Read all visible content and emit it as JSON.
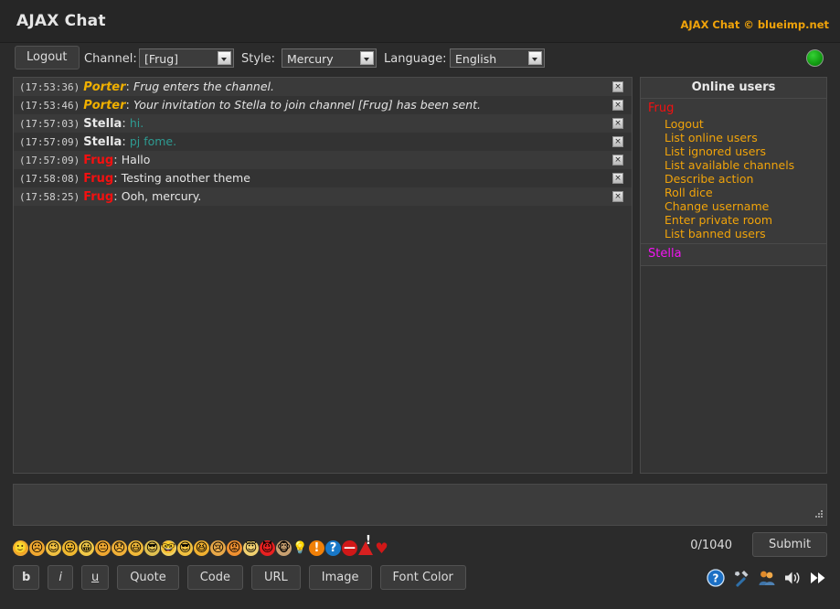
{
  "header": {
    "title": "AJAX Chat",
    "copyright_prefix": "AJAX Chat © ",
    "copyright_link": "blueimp.net"
  },
  "toolbar": {
    "logout_label": "Logout",
    "channel_label": "Channel:",
    "channel_value": "[Frug]",
    "style_label": "Style:",
    "style_value": "Mercury",
    "language_label": "Language:",
    "language_value": "English",
    "status": "online"
  },
  "messages": [
    {
      "time": "(17:53:36)",
      "user": "Porter",
      "user_class": "u-porter",
      "text": "Frug enters the channel.",
      "text_class": "t-action",
      "delete_label": "×"
    },
    {
      "time": "(17:53:46)",
      "user": "Porter",
      "user_class": "u-porter",
      "text": "Your invitation to Stella to join channel [Frug] has been sent.",
      "text_class": "t-action",
      "delete_label": "×"
    },
    {
      "time": "(17:57:03)",
      "user": "Stella",
      "user_class": "u-stella",
      "text": "hi.",
      "text_class": "t-teal",
      "delete_label": "×"
    },
    {
      "time": "(17:57:09)",
      "user": "Stella",
      "user_class": "u-stella",
      "text": "pj fome.",
      "text_class": "t-teal",
      "delete_label": "×"
    },
    {
      "time": "(17:57:09)",
      "user": "Frug",
      "user_class": "u-frug",
      "text": "Hallo",
      "text_class": "t-plain",
      "delete_label": "×"
    },
    {
      "time": "(17:58:08)",
      "user": "Frug",
      "user_class": "u-frug",
      "text": "Testing another theme",
      "text_class": "t-plain",
      "delete_label": "×"
    },
    {
      "time": "(17:58:25)",
      "user": "Frug",
      "user_class": "u-frug",
      "text": "Ooh, mercury.",
      "text_class": "t-plain",
      "delete_label": "×"
    }
  ],
  "users_panel": {
    "title": "Online users",
    "users": [
      {
        "name": "Frug",
        "color_class": "c-red",
        "menu": [
          "Logout",
          "List online users",
          "List ignored users",
          "List available channels",
          "Describe action",
          "Roll dice",
          "Change username",
          "Enter private room",
          "List banned users"
        ]
      },
      {
        "name": "Stella",
        "color_class": "c-magenta",
        "menu": []
      }
    ]
  },
  "input": {
    "value": "",
    "placeholder": ""
  },
  "emoticons": [
    {
      "name": "smile-emoticon",
      "glyph": "🙂",
      "bg": "#f0a830"
    },
    {
      "name": "frown-emoticon",
      "glyph": "☹",
      "bg": "#f0a830"
    },
    {
      "name": "wink-emoticon",
      "glyph": "😉",
      "bg": "#f0c040"
    },
    {
      "name": "tongue-emoticon",
      "glyph": "😛",
      "bg": "#f0b830"
    },
    {
      "name": "grin-emoticon",
      "glyph": "😀",
      "bg": "#f0c848"
    },
    {
      "name": "neutral-emoticon",
      "glyph": "😐",
      "bg": "#f0a830"
    },
    {
      "name": "sad-emoticon",
      "glyph": "😞",
      "bg": "#f0b038"
    },
    {
      "name": "happy-emoticon",
      "glyph": "😃",
      "bg": "#f0b838"
    },
    {
      "name": "cool-sunglasses-emoticon",
      "glyph": "😎",
      "bg": "#e0c050"
    },
    {
      "name": "nerd-glasses-emoticon",
      "glyph": "🤓",
      "bg": "#f0d060"
    },
    {
      "name": "shades-emoticon",
      "glyph": "😎",
      "bg": "#f0c040"
    },
    {
      "name": "laugh-emoticon",
      "glyph": "😆",
      "bg": "#f0b030"
    },
    {
      "name": "cry-emoticon",
      "glyph": "😢",
      "bg": "#e8a848"
    },
    {
      "name": "angry-emoticon",
      "glyph": "😡",
      "bg": "#f09030"
    },
    {
      "name": "angel-emoticon",
      "glyph": "😇",
      "bg": "#f0d070"
    },
    {
      "name": "devil-emoticon",
      "glyph": "😈",
      "bg": "#e82020"
    },
    {
      "name": "monkey-emoticon",
      "glyph": "🐵",
      "bg": "#c8a070"
    },
    {
      "name": "idea-lightbulb-icon",
      "glyph": "💡",
      "bg": "#dcdcdc"
    },
    {
      "name": "exclamation-icon",
      "glyph": "!",
      "bg": "#f08008"
    },
    {
      "name": "question-icon",
      "glyph": "?",
      "bg": "#1878c8"
    },
    {
      "name": "no-entry-icon",
      "glyph": "—",
      "bg": "#d01818"
    },
    {
      "name": "warning-icon",
      "glyph": "!",
      "bg": "#d82020"
    },
    {
      "name": "heart-icon",
      "glyph": "♥",
      "bg": "#d01818"
    }
  ],
  "format_buttons": [
    {
      "label": "b",
      "name": "bold-button",
      "class": "b"
    },
    {
      "label": "i",
      "name": "italic-button",
      "class": "i"
    },
    {
      "label": "u",
      "name": "underline-button",
      "class": "u"
    },
    {
      "label": "Quote",
      "name": "quote-button",
      "class": ""
    },
    {
      "label": "Code",
      "name": "code-button",
      "class": ""
    },
    {
      "label": "URL",
      "name": "url-button",
      "class": ""
    },
    {
      "label": "Image",
      "name": "image-button",
      "class": ""
    },
    {
      "label": "Font Color",
      "name": "font-color-button",
      "class": ""
    }
  ],
  "submit": {
    "counter": "0/1040",
    "label": "Submit"
  },
  "action_icons": [
    {
      "name": "help-icon"
    },
    {
      "name": "settings-tools-icon"
    },
    {
      "name": "users-icon"
    },
    {
      "name": "sound-icon"
    },
    {
      "name": "fast-forward-icon"
    }
  ],
  "colors": {
    "page_bg": "#2b2b2b",
    "panel_bg": "#343434",
    "accent_orange": "#f0a30a",
    "user_red": "#f41010",
    "user_magenta": "#f414f4",
    "text_teal": "#2e9b92",
    "status_green": "#14a114"
  }
}
